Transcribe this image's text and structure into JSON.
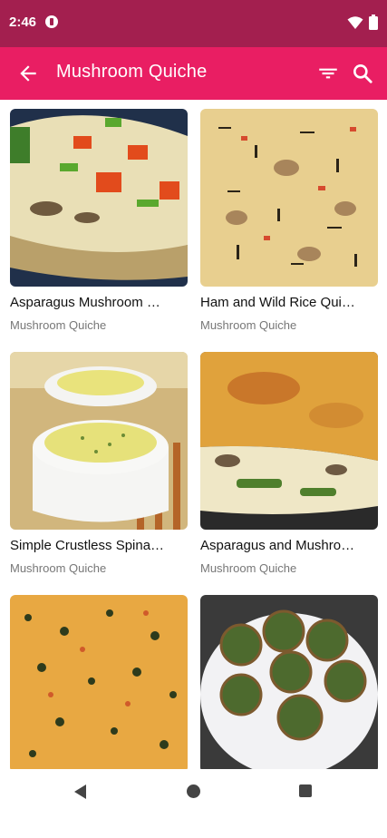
{
  "status_bar": {
    "time": "2:46"
  },
  "app_bar": {
    "title": "Mushroom Quiche"
  },
  "recipes": [
    {
      "name": "Asparagus Mushroom …",
      "category": "Mushroom Quiche"
    },
    {
      "name": "Ham and Wild Rice Qui…",
      "category": "Mushroom Quiche"
    },
    {
      "name": "Simple Crustless Spina…",
      "category": "Mushroom Quiche"
    },
    {
      "name": "Asparagus and Mushro…",
      "category": "Mushroom Quiche"
    },
    {
      "name": "",
      "category": ""
    },
    {
      "name": "",
      "category": ""
    }
  ],
  "colors": {
    "status_bar": "#a31f4f",
    "app_bar": "#e91e63"
  },
  "icons": [
    "back-arrow-icon",
    "filter-icon",
    "search-icon",
    "wifi-icon",
    "battery-icon"
  ]
}
